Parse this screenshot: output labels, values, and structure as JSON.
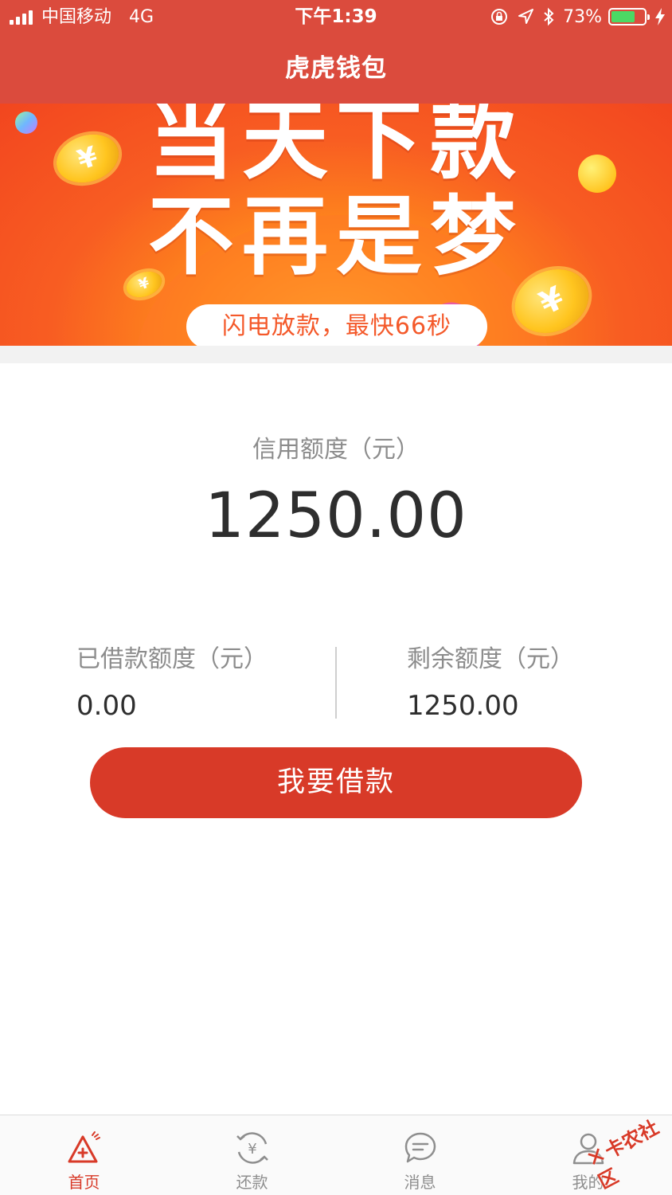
{
  "status_bar": {
    "carrier": "中国移动",
    "network": "4G",
    "time": "下午1:39",
    "battery_percent": "73%",
    "battery_level": 0.73
  },
  "nav": {
    "title": "虎虎钱包"
  },
  "banner": {
    "headline_1": "当天下款",
    "headline_2": "不再是梦",
    "pill": "闪电放款，最快66秒",
    "coin_symbol": "¥"
  },
  "credit": {
    "label": "信用额度（元）",
    "value": "1250.00"
  },
  "borrowed": {
    "label": "已借款额度（元）",
    "value": "0.00"
  },
  "remaining": {
    "label": "剩余额度（元）",
    "value": "1250.00"
  },
  "borrow_button": {
    "label": "我要借款"
  },
  "tabs": [
    {
      "label": "首页",
      "icon": "home-triangle-icon",
      "active": true
    },
    {
      "label": "还款",
      "icon": "repay-yen-icon",
      "active": false
    },
    {
      "label": "消息",
      "icon": "message-bubble-icon",
      "active": false
    },
    {
      "label": "我的",
      "icon": "user-icon",
      "active": false
    }
  ],
  "watermark": {
    "text": "卡农社区"
  },
  "colors": {
    "brand_red": "#db4b3d",
    "button_red": "#d83a28",
    "banner_orange": "#f85d22",
    "battery_green": "#4cd964"
  }
}
